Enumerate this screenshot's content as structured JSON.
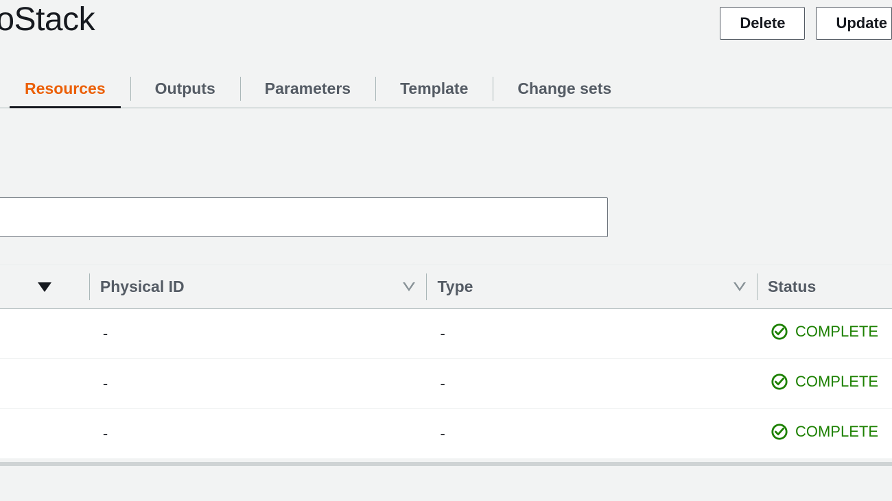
{
  "header": {
    "title": "dioStack",
    "actions": {
      "delete_label": "Delete",
      "update_label": "Update"
    }
  },
  "tabs": [
    {
      "label": "Resources",
      "active": true
    },
    {
      "label": "Outputs",
      "active": false
    },
    {
      "label": "Parameters",
      "active": false
    },
    {
      "label": "Template",
      "active": false
    },
    {
      "label": "Change sets",
      "active": false
    }
  ],
  "search": {
    "value": "",
    "placeholder": ""
  },
  "table": {
    "columns": {
      "physical_id": "Physical ID",
      "type": "Type",
      "status": "Status"
    },
    "rows": [
      {
        "physical_id": "-",
        "type": "-",
        "status": "COMPLETE"
      },
      {
        "physical_id": "-",
        "type": "-",
        "status": "COMPLETE"
      },
      {
        "physical_id": "-",
        "type": "-",
        "status": "COMPLETE"
      }
    ]
  }
}
